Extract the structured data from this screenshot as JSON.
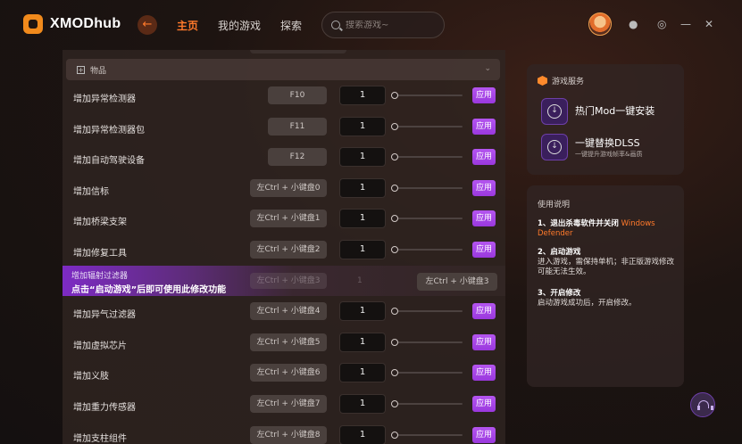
{
  "app": {
    "name": "XMODhub"
  },
  "nav": {
    "items": [
      "主页",
      "我的游戏",
      "探索"
    ],
    "active": 0
  },
  "search": {
    "placeholder": "搜索游戏~"
  },
  "section": {
    "title": "物品"
  },
  "apply_label": "应用",
  "rows": [
    {
      "label": "增加异常检测器",
      "hotkey": "F10",
      "qty": "1"
    },
    {
      "label": "增加异常检测器包",
      "hotkey": "F11",
      "qty": "1"
    },
    {
      "label": "增加自动驾驶设备",
      "hotkey": "F12",
      "qty": "1"
    },
    {
      "label": "增加信标",
      "hotkey": "左Ctrl + 小键盘0",
      "qty": "1"
    },
    {
      "label": "增加桥梁支架",
      "hotkey": "左Ctrl + 小键盘1",
      "qty": "1"
    },
    {
      "label": "增加修复工具",
      "hotkey": "左Ctrl + 小键盘2",
      "qty": "1"
    },
    {
      "label": "增加异气过滤器",
      "hotkey": "左Ctrl + 小键盘4",
      "qty": "1"
    },
    {
      "label": "增加虚拟芯片",
      "hotkey": "左Ctrl + 小键盘5",
      "qty": "1"
    },
    {
      "label": "增加义肢",
      "hotkey": "左Ctrl + 小键盘6",
      "qty": "1"
    },
    {
      "label": "增加重力传感器",
      "hotkey": "左Ctrl + 小键盘7",
      "qty": "1"
    },
    {
      "label": "增加支柱组件",
      "hotkey": "左Ctrl + 小键盘8",
      "qty": "1"
    }
  ],
  "highlight_row": {
    "label": "增加辐射过滤器",
    "notice": "点击“启动游戏”后即可使用此修改功能",
    "ghost_hotkey": "左Ctrl + 小键盘3",
    "ghost_qty": "1",
    "hotkey": "左Ctrl + 小键盘3"
  },
  "services": {
    "title": "游戏服务",
    "items": [
      {
        "name": "热门Mod一键安装",
        "sub": ""
      },
      {
        "name": "一键替换DLSS",
        "sub": "一键提升游戏帧率&画质"
      }
    ]
  },
  "help": {
    "title": "使用说明",
    "steps": [
      {
        "num": "1、",
        "head": "退出杀毒软件并关闭",
        "highlight": "Windows Defender",
        "body": ""
      },
      {
        "num": "2、",
        "head": "启动游戏",
        "highlight": "",
        "body": "进入游戏，需保持单机；非正版游戏修改可能无法生效。"
      },
      {
        "num": "3、",
        "head": "开启修改",
        "highlight": "",
        "body": "启动游戏成功后，开启修改。"
      }
    ]
  },
  "colors": {
    "accent": "#ff7a2b",
    "purple": "#a346e6",
    "brand": "#f18a1c"
  }
}
